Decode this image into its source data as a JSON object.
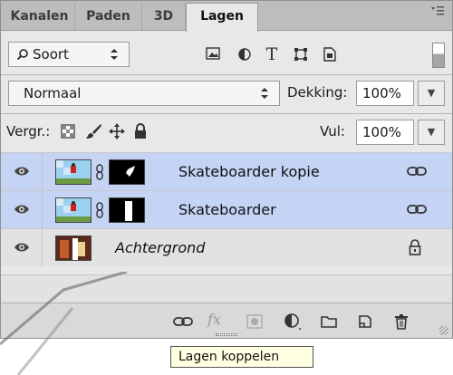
{
  "tabs": [
    {
      "label": "Kanalen",
      "active": false
    },
    {
      "label": "Paden",
      "active": false
    },
    {
      "label": "3D",
      "active": false
    },
    {
      "label": "Lagen",
      "active": true
    }
  ],
  "panel_menu_icon": "panel-menu-icon",
  "filter": {
    "search_icon": "search-icon",
    "kind_label": "Soort",
    "icons": [
      "image-filter-icon",
      "adjustment-filter-icon",
      "type-filter-icon",
      "shape-filter-icon",
      "smart-object-filter-icon"
    ],
    "type_glyph": "T"
  },
  "blend": {
    "mode": "Normaal",
    "opacity_label": "Dekking:",
    "opacity_value": "100%"
  },
  "lock": {
    "label": "Vergr.:",
    "icons": [
      "lock-transparent-icon",
      "lock-image-icon",
      "lock-position-icon",
      "lock-all-icon"
    ],
    "fill_label": "Vul:",
    "fill_value": "100%"
  },
  "layers": [
    {
      "name": "Skateboarder kopie",
      "selected": true,
      "italic": false,
      "mask": true,
      "linked": true
    },
    {
      "name": "Skateboarder",
      "selected": true,
      "italic": false,
      "mask": true,
      "linked": true
    },
    {
      "name": "Achtergrond",
      "selected": false,
      "italic": true,
      "mask": false,
      "locked": true
    }
  ],
  "bottom_icons": [
    "link-layers-icon",
    "fx-icon",
    "add-mask-icon",
    "adjustment-layer-icon",
    "folder-icon",
    "new-layer-icon",
    "trash-icon"
  ],
  "tooltip": "Lagen koppelen",
  "colors": {
    "selected_row": "#c5d3f5",
    "panel_bg": "#e8e8e8",
    "tabbar_bg": "#bdbdbd",
    "tooltip_bg": "#ffffe1"
  }
}
